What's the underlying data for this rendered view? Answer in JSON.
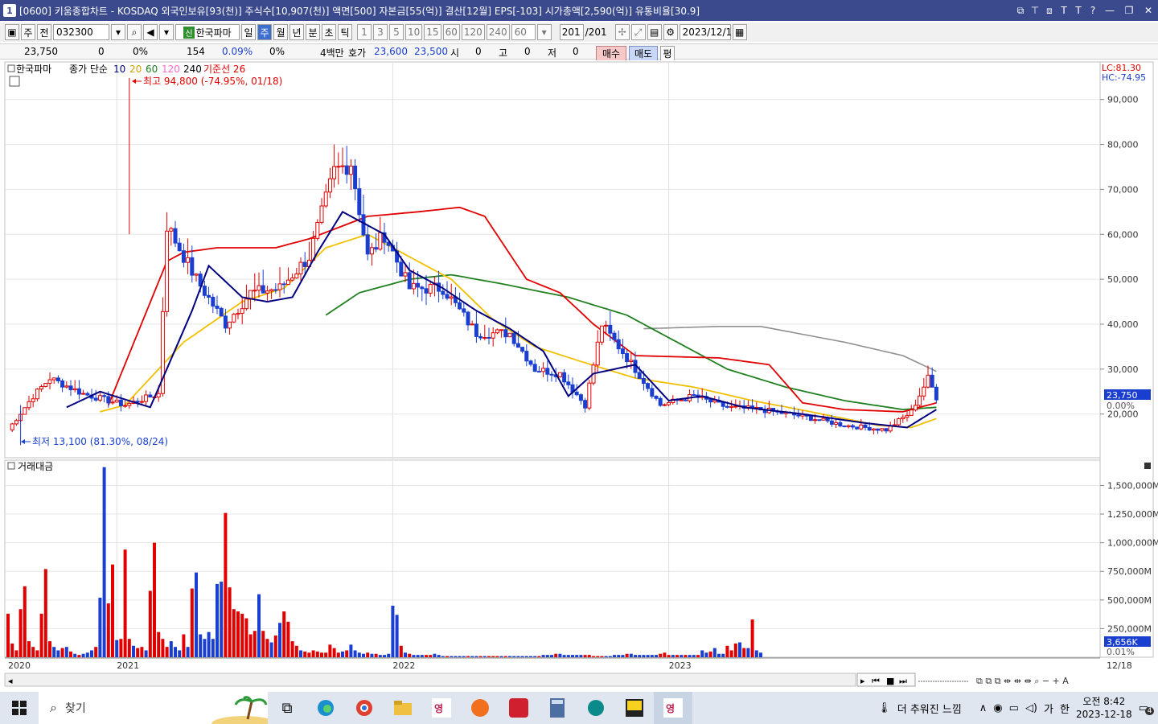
{
  "window": {
    "number": "1",
    "title": "[0600] 키움종합차트 - KOSDAQ 외국인보유[93(천)] 주식수[10,907(천)] 액면[500] 자본금[55(억)] 결산[12월] EPS[-103] 시가총액[2,590(억)] 유통비율[30.9]",
    "buttons": [
      "⧉",
      "⊤",
      "⧈",
      "T",
      "T",
      "?",
      "—",
      "❐",
      "✕"
    ]
  },
  "toolbar": {
    "period_type": "주",
    "market": "전",
    "code": "032300",
    "stock_badge": "신",
    "stock_name": "한국파마",
    "intervals": [
      "일",
      "주",
      "월",
      "년",
      "분",
      "초",
      "틱"
    ],
    "active_interval": "주",
    "numbers": [
      "1",
      "3",
      "5",
      "10",
      "15",
      "60",
      "120",
      "240",
      "60"
    ],
    "count": "201",
    "count_total": "/201",
    "date": "2023/12/18"
  },
  "quote": {
    "price": "23,750",
    "change": "0",
    "change_pct": "0%",
    "volume": "154",
    "volume_pct": "0.09%",
    "turnover_pct": "0%",
    "turnover": "4백만",
    "hoga_label": "호가",
    "ask": "23,600",
    "bid": "23,500",
    "open_label": "시",
    "open": "0",
    "high_label": "고",
    "high": "0",
    "low_label": "저",
    "low": "0",
    "buy": "매수",
    "sell": "매도",
    "avg": "평"
  },
  "colors": {
    "up": "#e00000",
    "down": "#1a3fd0",
    "ma10": "#000080",
    "ma20": "#f0c000",
    "ma60": "#208020",
    "ma120": "#ff66cc",
    "ma240": "#909090",
    "kijun": "#e00000"
  },
  "chart_data": [
    {
      "type": "candlestick",
      "legend": {
        "stock": "한국파마",
        "series": "종가 단순",
        "ma10": "10",
        "ma20": "20",
        "ma60": "60",
        "ma120": "120",
        "ma240": "240",
        "kijun": "기준선 26"
      },
      "lc": "LC:81.30",
      "hc": "HC:-74.95",
      "current_price": "23,750",
      "ylim": [
        11000,
        98000
      ],
      "yticks": [
        "20,000",
        "30,000",
        "40,000",
        "50,000",
        "60,000",
        "70,000",
        "80,000",
        "90,000"
      ],
      "high_annotation": "최고 94,800 (-74.95%, 01/18)",
      "low_annotation": "최저 13,100 (81.30%, 08/24)",
      "close_keypoints": [
        [
          0,
          16500
        ],
        [
          6,
          24000
        ],
        [
          10,
          28000
        ],
        [
          18,
          24500
        ],
        [
          28,
          22000
        ],
        [
          36,
          24500
        ],
        [
          38,
          62000
        ],
        [
          45,
          50000
        ],
        [
          52,
          40000
        ],
        [
          58,
          47000
        ],
        [
          65,
          48000
        ],
        [
          72,
          55000
        ],
        [
          78,
          74000
        ],
        [
          82,
          76000
        ],
        [
          86,
          55000
        ],
        [
          90,
          60000
        ],
        [
          96,
          48000
        ],
        [
          104,
          48000
        ],
        [
          112,
          38000
        ],
        [
          120,
          38000
        ],
        [
          126,
          30000
        ],
        [
          132,
          29000
        ],
        [
          138,
          22000
        ],
        [
          142,
          40000
        ],
        [
          150,
          30000
        ],
        [
          156,
          22000
        ],
        [
          164,
          24000
        ],
        [
          172,
          21500
        ],
        [
          180,
          21000
        ],
        [
          190,
          19500
        ],
        [
          200,
          17500
        ],
        [
          210,
          16500
        ],
        [
          216,
          20500
        ],
        [
          220,
          28000
        ],
        [
          222,
          23750
        ]
      ],
      "ma10_keypoints": [
        [
          14,
          21500
        ],
        [
          22,
          25000
        ],
        [
          34,
          21500
        ],
        [
          44,
          43000
        ],
        [
          48,
          53000
        ],
        [
          56,
          46000
        ],
        [
          62,
          45000
        ],
        [
          68,
          46000
        ],
        [
          74,
          56000
        ],
        [
          80,
          65000
        ],
        [
          90,
          60000
        ],
        [
          96,
          52000
        ],
        [
          104,
          48000
        ],
        [
          112,
          43000
        ],
        [
          120,
          39000
        ],
        [
          128,
          34000
        ],
        [
          134,
          24000
        ],
        [
          140,
          29000
        ],
        [
          150,
          31000
        ],
        [
          158,
          23000
        ],
        [
          166,
          24000
        ],
        [
          176,
          21500
        ],
        [
          190,
          20000
        ],
        [
          205,
          18000
        ],
        [
          215,
          17000
        ],
        [
          222,
          21000
        ]
      ],
      "ma20_keypoints": [
        [
          22,
          20500
        ],
        [
          28,
          22000
        ],
        [
          42,
          36000
        ],
        [
          56,
          45000
        ],
        [
          66,
          48000
        ],
        [
          76,
          57000
        ],
        [
          86,
          60000
        ],
        [
          96,
          55000
        ],
        [
          106,
          50000
        ],
        [
          116,
          41000
        ],
        [
          126,
          35000
        ],
        [
          136,
          32000
        ],
        [
          150,
          28000
        ],
        [
          164,
          26000
        ],
        [
          178,
          23000
        ],
        [
          192,
          20500
        ],
        [
          208,
          17500
        ],
        [
          216,
          17000
        ],
        [
          222,
          19000
        ]
      ],
      "ma60_keypoints": [
        [
          76,
          42000
        ],
        [
          84,
          47000
        ],
        [
          96,
          50000
        ],
        [
          106,
          51000
        ],
        [
          118,
          49000
        ],
        [
          134,
          46000
        ],
        [
          148,
          42000
        ],
        [
          160,
          36000
        ],
        [
          172,
          30000
        ],
        [
          186,
          26000
        ],
        [
          200,
          23000
        ],
        [
          214,
          21000
        ],
        [
          222,
          21500
        ]
      ],
      "ma240_keypoints": [
        [
          152,
          39000
        ],
        [
          170,
          39500
        ],
        [
          180,
          39500
        ],
        [
          200,
          36000
        ],
        [
          214,
          33000
        ],
        [
          222,
          29500
        ]
      ],
      "kijun_keypoints": [
        [
          24,
          22000
        ],
        [
          38,
          54000
        ],
        [
          42,
          56000
        ],
        [
          50,
          57000
        ],
        [
          64,
          57000
        ],
        [
          72,
          59000
        ],
        [
          86,
          64000
        ],
        [
          98,
          65000
        ],
        [
          108,
          66000
        ],
        [
          114,
          64000
        ],
        [
          124,
          50000
        ],
        [
          132,
          47000
        ],
        [
          140,
          40000
        ],
        [
          150,
          33000
        ],
        [
          170,
          32500
        ],
        [
          182,
          31000
        ],
        [
          190,
          22500
        ],
        [
          200,
          21000
        ],
        [
          214,
          20500
        ],
        [
          222,
          22500
        ]
      ]
    },
    {
      "type": "bar",
      "label": "거래대금",
      "ylim": [
        0,
        1700
      ],
      "yticks": [
        "250,000M",
        "500,000M",
        "750,000M",
        "1,000,000M",
        "1,250,000M",
        "1,500,000M"
      ],
      "current": "3,656K",
      "zero_pct": "0.01%",
      "unit": "M (백만원)",
      "values_M": [
        380,
        120,
        60,
        420,
        620,
        140,
        90,
        60,
        380,
        770,
        140,
        90,
        60,
        80,
        90,
        50,
        30,
        20,
        30,
        40,
        60,
        90,
        520,
        1660,
        470,
        810,
        150,
        160,
        940,
        160,
        100,
        80,
        90,
        60,
        580,
        1000,
        220,
        160,
        90,
        140,
        90,
        60,
        200,
        90,
        600,
        740,
        200,
        160,
        220,
        160,
        640,
        660,
        1260,
        610,
        420,
        400,
        380,
        340,
        200,
        230,
        550,
        230,
        160,
        130,
        190,
        300,
        400,
        310,
        140,
        100,
        60,
        50,
        40,
        60,
        50,
        40,
        40,
        110,
        80,
        40,
        50,
        60,
        110,
        60,
        40,
        30,
        40,
        30,
        30,
        20,
        20,
        30,
        450,
        370,
        100,
        40,
        30,
        20,
        20,
        20,
        20,
        20,
        30,
        20,
        10,
        10,
        10,
        10,
        10,
        10,
        10,
        10,
        10,
        10,
        10,
        10,
        10,
        10,
        10,
        10,
        10,
        10,
        10,
        10,
        10,
        10,
        10,
        10,
        20,
        20,
        20,
        30,
        30,
        20,
        20,
        20,
        20,
        20,
        20,
        20,
        10,
        10,
        10,
        10,
        10,
        20,
        20,
        20,
        30,
        30,
        20,
        20,
        20,
        20,
        20,
        20,
        30,
        40,
        20,
        20,
        20,
        20,
        20,
        20,
        20,
        20,
        60,
        40,
        50,
        80,
        30,
        30,
        100,
        60,
        120,
        130,
        80,
        80,
        330,
        60,
        40
      ]
    }
  ],
  "xaxis": {
    "labels": [
      "2020",
      "2021",
      "2022",
      "2023",
      "12/18"
    ]
  },
  "taskbar": {
    "search_placeholder": "찾기",
    "weather": "더 추워진 느낌",
    "ime1": "가",
    "ime2": "한",
    "time": "오전 8:42",
    "date": "2023-12-18",
    "notifications": "4"
  }
}
